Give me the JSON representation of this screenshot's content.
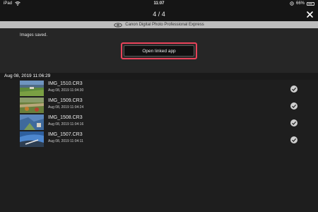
{
  "status_bar": {
    "device": "iPad",
    "time": "11:07",
    "battery_percent": "66%"
  },
  "nav": {
    "title": "4 / 4"
  },
  "banner": {
    "app_name": "Canon Digital Photo Professional Express"
  },
  "saved": {
    "message": "Images saved.",
    "open_button_label": "Open linked app"
  },
  "date_header": "Aug 08, 2019  11:06:29",
  "images": [
    {
      "name": "IMG_1510.CR3",
      "timestamp": "Aug 08, 2019  11:04:30"
    },
    {
      "name": "IMG_1509.CR3",
      "timestamp": "Aug 08, 2019  11:04:24"
    },
    {
      "name": "IMG_1508.CR3",
      "timestamp": "Aug 08, 2019  11:04:16"
    },
    {
      "name": "IMG_1507.CR3",
      "timestamp": "Aug 08, 2019  11:04:11"
    }
  ],
  "colors": {
    "highlight": "#e8435a",
    "check": "#cfcfcf"
  }
}
